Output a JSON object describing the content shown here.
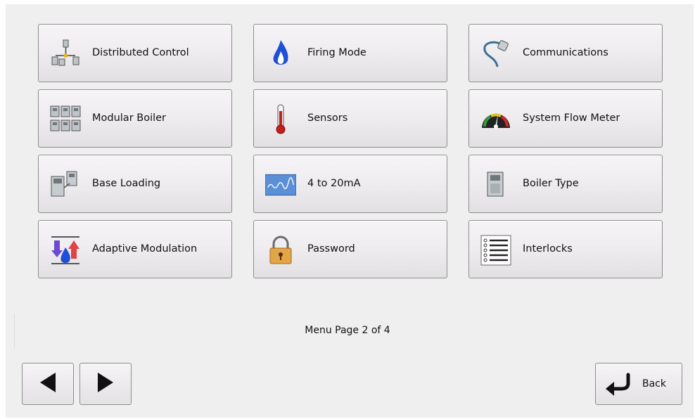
{
  "menu": {
    "items": [
      {
        "label": "Distributed Control",
        "icon": "network-icon"
      },
      {
        "label": "Firing Mode",
        "icon": "flame-icon"
      },
      {
        "label": "Communications",
        "icon": "cable-icon"
      },
      {
        "label": "Modular Boiler",
        "icon": "boiler-array-icon"
      },
      {
        "label": "Sensors",
        "icon": "thermometer-icon"
      },
      {
        "label": "System Flow Meter",
        "icon": "gauge-icon"
      },
      {
        "label": "Base Loading",
        "icon": "boiler-pair-icon"
      },
      {
        "label": "4 to 20mA",
        "icon": "signal-wave-icon"
      },
      {
        "label": "Boiler Type",
        "icon": "boiler-icon"
      },
      {
        "label": "Adaptive Modulation",
        "icon": "modulation-icon"
      },
      {
        "label": "Password",
        "icon": "padlock-icon"
      },
      {
        "label": "Interlocks",
        "icon": "checklist-icon"
      }
    ]
  },
  "pagination": {
    "label": "Menu Page 2 of 4",
    "prev_icon": "arrow-left-icon",
    "next_icon": "arrow-right-icon"
  },
  "back": {
    "label": "Back",
    "icon": "return-arrow-icon"
  },
  "colors": {
    "panel_bg": "#efefef",
    "button_border": "#8e8e8e",
    "flame_blue": "#1e4fd6"
  }
}
